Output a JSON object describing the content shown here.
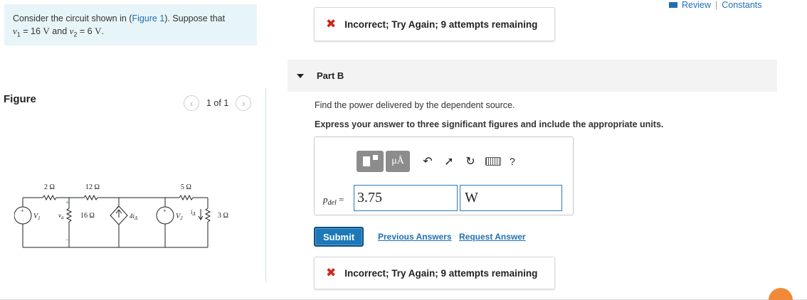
{
  "problem": {
    "text_before": "Consider the circuit shown in (",
    "figure_link": "Figure 1",
    "text_after": "). Suppose that",
    "v1_var": "v",
    "v1_sub": "1",
    "v1_value": " = 16 ",
    "v1_unit": "V",
    "and": " and ",
    "v2_var": "v",
    "v2_sub": "2",
    "v2_value": " = 6 ",
    "v2_unit": "V",
    "period": "."
  },
  "figure": {
    "label": "Figure",
    "pager_text": "1 of 1",
    "prev_icon": "chevron-left-icon",
    "next_icon": "chevron-right-icon",
    "circuit": {
      "r1": "2 Ω",
      "r2": "12 Ω",
      "r3": "5 Ω",
      "r4": "16 Ω",
      "r5": "3 Ω",
      "v1_label": "V",
      "v1_sub": "1",
      "v2_label": "V",
      "v2_sub": "2",
      "va_label": "v",
      "va_sub": "a",
      "dep_label": "4i",
      "dep_sub": "Δ",
      "i_label": "i",
      "i_sub": "Δ",
      "plus": "+",
      "minus": "−"
    }
  },
  "header": {
    "review": "Review",
    "separator": "|",
    "constants": "Constants"
  },
  "feedback_top": {
    "icon": "x-icon",
    "text": "Incorrect; Try Again; 9 attempts remaining"
  },
  "part_b": {
    "title": "Part B",
    "question": "Find the power delivered by the dependent source.",
    "instruction": "Express your answer to three significant figures and include the appropriate units.",
    "toolbar": {
      "units_button": "μÅ",
      "help": "?"
    },
    "answer_label_var": "p",
    "answer_label_sub": "del",
    "answer_label_eq": " =",
    "answer_value": "3.75",
    "answer_unit": "W",
    "submit": "Submit",
    "previous_answers": "Previous Answers",
    "request_answer": "Request Answer"
  },
  "feedback_bottom": {
    "icon": "x-icon",
    "text": "Incorrect; Try Again; 9 attempts remaining"
  },
  "colors": {
    "accent": "#1d78b8",
    "link": "#1f6fb2",
    "error": "#d0261b",
    "problem_bg": "#e8f5f8"
  }
}
